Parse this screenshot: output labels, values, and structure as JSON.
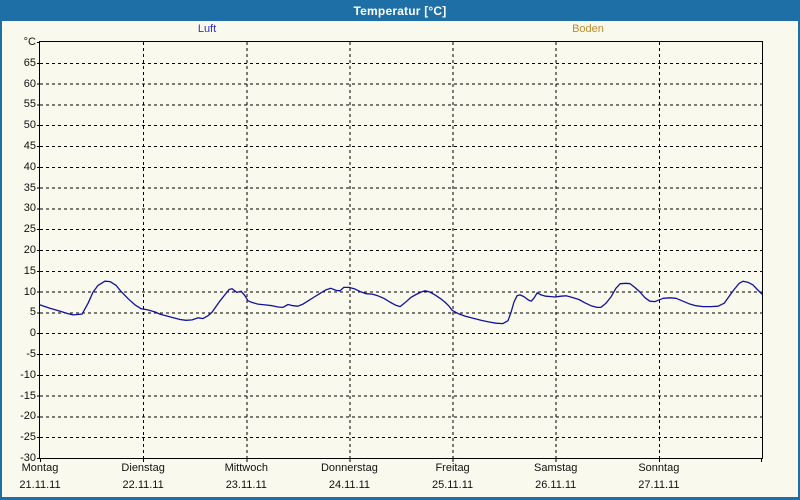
{
  "window": {
    "title": "Temperatur [°C]"
  },
  "legend": [
    {
      "label": "Luft",
      "color": "#2f2fc1"
    },
    {
      "label": "Boden",
      "color": "#bf8b2e"
    }
  ],
  "colors": {
    "title_bar": "#1d6fa5",
    "window_border": "#1d6fa5",
    "background": "#f9f9ee",
    "grid": "#000000",
    "luft_line": "#12129c"
  },
  "chart_data": {
    "type": "line",
    "title": "Temperatur [°C]",
    "grid": "dashed",
    "legend_position": "top",
    "x_axis": {
      "unit": "hours since Montag 21.11.11 00:00",
      "range_hours": [
        0,
        168
      ],
      "days": [
        {
          "name": "Montag",
          "date": "21.11.11",
          "start_hour": 0
        },
        {
          "name": "Dienstag",
          "date": "22.11.11",
          "start_hour": 24
        },
        {
          "name": "Mittwoch",
          "date": "23.11.11",
          "start_hour": 48
        },
        {
          "name": "Donnerstag",
          "date": "24.11.11",
          "start_hour": 72
        },
        {
          "name": "Freitag",
          "date": "25.11.11",
          "start_hour": 96
        },
        {
          "name": "Samstag",
          "date": "26.11.11",
          "start_hour": 120
        },
        {
          "name": "Sonntag",
          "date": "27.11.11",
          "start_hour": 144
        }
      ]
    },
    "y_axis": {
      "unit": "°C",
      "range": [
        -30,
        70
      ],
      "tick_step": 5,
      "tick_labels": [
        "65",
        "60",
        "55",
        "50",
        "45",
        "40",
        "35",
        "30",
        "25",
        "20",
        "15",
        "10",
        "5",
        "0",
        "-5",
        "-10",
        "-15",
        "-20",
        "-25",
        "-30"
      ]
    },
    "series": [
      {
        "name": "Luft",
        "color": "#12129c",
        "points": [
          [
            0,
            6.8
          ],
          [
            2.3,
            6.0
          ],
          [
            4.7,
            5.3
          ],
          [
            6.5,
            4.7
          ],
          [
            7.7,
            4.4
          ],
          [
            8.8,
            4.5
          ],
          [
            9.8,
            4.6
          ],
          [
            11.2,
            7.2
          ],
          [
            12.3,
            9.8
          ],
          [
            13.5,
            11.5
          ],
          [
            15.1,
            12.5
          ],
          [
            16.3,
            12.4
          ],
          [
            17.7,
            11.5
          ],
          [
            18.8,
            10.1
          ],
          [
            20.5,
            8.3
          ],
          [
            22.1,
            6.8
          ],
          [
            23.5,
            5.9
          ],
          [
            25.1,
            5.6
          ],
          [
            26.8,
            5.1
          ],
          [
            27.9,
            4.6
          ],
          [
            29.3,
            4.2
          ],
          [
            30.7,
            3.8
          ],
          [
            32.6,
            3.3
          ],
          [
            34,
            3.1
          ],
          [
            35.4,
            3.2
          ],
          [
            36.8,
            3.7
          ],
          [
            37.9,
            3.5
          ],
          [
            39.1,
            4.2
          ],
          [
            40,
            5.0
          ],
          [
            41,
            6.5
          ],
          [
            41.9,
            7.8
          ],
          [
            43,
            9.2
          ],
          [
            44,
            10.5
          ],
          [
            44.7,
            10.7
          ],
          [
            45.8,
            9.8
          ],
          [
            46.8,
            10.1
          ],
          [
            47.7,
            9.0
          ],
          [
            48.4,
            7.8
          ],
          [
            49.3,
            7.4
          ],
          [
            50.7,
            7.0
          ],
          [
            52.4,
            6.8
          ],
          [
            54,
            6.6
          ],
          [
            55.4,
            6.3
          ],
          [
            56.5,
            6.2
          ],
          [
            57.7,
            6.9
          ],
          [
            58.9,
            6.6
          ],
          [
            60,
            6.5
          ],
          [
            61.2,
            7.0
          ],
          [
            62.4,
            7.8
          ],
          [
            63.8,
            8.7
          ],
          [
            65.2,
            9.6
          ],
          [
            66.5,
            10.4
          ],
          [
            67.7,
            10.8
          ],
          [
            68.9,
            10.3
          ],
          [
            69.8,
            10.2
          ],
          [
            70.7,
            11.0
          ],
          [
            71.9,
            11.0
          ],
          [
            73.1,
            10.7
          ],
          [
            74.5,
            10.0
          ],
          [
            75.9,
            9.5
          ],
          [
            77.3,
            9.4
          ],
          [
            78.6,
            9.0
          ],
          [
            80,
            8.4
          ],
          [
            81.4,
            7.5
          ],
          [
            82.8,
            6.7
          ],
          [
            83.8,
            6.4
          ],
          [
            84.9,
            7.3
          ],
          [
            86.3,
            8.6
          ],
          [
            87.5,
            9.3
          ],
          [
            88.7,
            9.9
          ],
          [
            89.6,
            10.2
          ],
          [
            90.7,
            9.9
          ],
          [
            91.9,
            9.2
          ],
          [
            93.1,
            8.4
          ],
          [
            94.2,
            7.5
          ],
          [
            95.2,
            6.5
          ],
          [
            95.9,
            5.5
          ],
          [
            97.3,
            4.7
          ],
          [
            98.9,
            4.1
          ],
          [
            100.8,
            3.6
          ],
          [
            102.6,
            3.1
          ],
          [
            104.5,
            2.7
          ],
          [
            106.1,
            2.4
          ],
          [
            107.7,
            2.3
          ],
          [
            108.9,
            3.0
          ],
          [
            109.6,
            5.0
          ],
          [
            110.3,
            7.5
          ],
          [
            111,
            9.0
          ],
          [
            111.7,
            9.2
          ],
          [
            112.6,
            8.8
          ],
          [
            113.6,
            8.0
          ],
          [
            114.3,
            7.7
          ],
          [
            115,
            8.5
          ],
          [
            115.7,
            9.7
          ],
          [
            116.6,
            9.2
          ],
          [
            117.7,
            8.9
          ],
          [
            118.9,
            8.8
          ],
          [
            119.8,
            8.7
          ],
          [
            121.2,
            8.9
          ],
          [
            122.4,
            9.0
          ],
          [
            123.8,
            8.6
          ],
          [
            125.4,
            8.1
          ],
          [
            126.8,
            7.3
          ],
          [
            128.2,
            6.6
          ],
          [
            129.6,
            6.2
          ],
          [
            130.5,
            6.2
          ],
          [
            131.7,
            7.2
          ],
          [
            132.9,
            8.8
          ],
          [
            134,
            10.8
          ],
          [
            135,
            11.9
          ],
          [
            136.4,
            12.0
          ],
          [
            137.3,
            11.9
          ],
          [
            138.4,
            11.0
          ],
          [
            139.6,
            9.9
          ],
          [
            140.8,
            8.5
          ],
          [
            141.9,
            7.7
          ],
          [
            143.1,
            7.6
          ],
          [
            143.8,
            7.9
          ],
          [
            145,
            8.4
          ],
          [
            146.6,
            8.5
          ],
          [
            148,
            8.4
          ],
          [
            149.4,
            7.8
          ],
          [
            151,
            7.1
          ],
          [
            152.6,
            6.6
          ],
          [
            154.3,
            6.4
          ],
          [
            156.1,
            6.4
          ],
          [
            157.8,
            6.5
          ],
          [
            159.2,
            7.2
          ],
          [
            160.3,
            8.8
          ],
          [
            161.5,
            10.5
          ],
          [
            162.7,
            12.0
          ],
          [
            163.6,
            12.5
          ],
          [
            164.8,
            12.2
          ],
          [
            165.9,
            11.6
          ],
          [
            166.9,
            10.5
          ],
          [
            168,
            9.4
          ]
        ]
      },
      {
        "name": "Boden",
        "color": "#bf8b2e",
        "points": []
      }
    ]
  }
}
